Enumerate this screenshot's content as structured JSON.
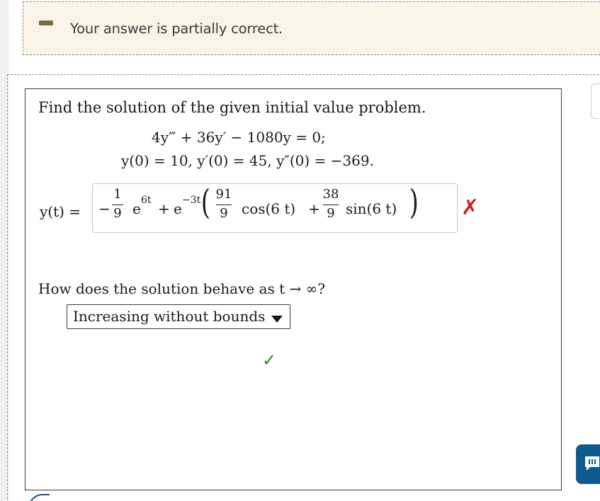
{
  "feedback": {
    "message": "Your answer is partially correct."
  },
  "question": {
    "prompt": "Find the solution of the given initial value problem.",
    "equation": "4y‴ + 36y′ − 1080y = 0;",
    "initial_conditions": "y(0) = 10,  y′(0) = 45,  y″(0) = −369."
  },
  "answer": {
    "label": "y(t) =",
    "minus": "−",
    "coef1_num": "1",
    "coef1_den": "9",
    "e1": "e",
    "e1_exp": "6t",
    "plus": "+",
    "e2": "e",
    "e2_exp": "−3t",
    "coef2_num": "91",
    "coef2_den": "9",
    "cos_term": "cos(6 t)",
    "plus2": "+",
    "coef3_num": "38",
    "coef3_den": "9",
    "sin_term": "sin(6 t)",
    "status_mark": "✗"
  },
  "behavior": {
    "question": "How does the solution behave as t → ∞?",
    "selected": "Increasing without bounds",
    "status_mark": "✓"
  },
  "colors": {
    "incorrect": "#cc1f1f",
    "correct": "#2e8b1e",
    "chat_button": "#0e5a8f"
  },
  "icons": {
    "partial": "minus-bar-icon",
    "chat": "chat-icon",
    "dropdown": "caret-down-icon"
  }
}
